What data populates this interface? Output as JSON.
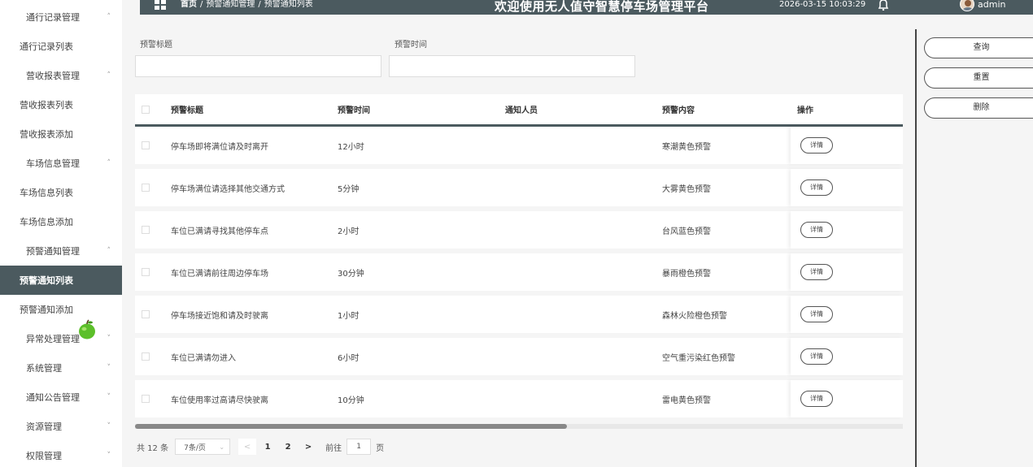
{
  "sidebar": {
    "items": [
      {
        "label": "通行记录管理",
        "type": "group",
        "chevron": "^"
      },
      {
        "label": "通行记录列表",
        "type": "link"
      },
      {
        "label": "营收报表管理",
        "type": "group",
        "chevron": "^"
      },
      {
        "label": "营收报表列表",
        "type": "link"
      },
      {
        "label": "营收报表添加",
        "type": "link"
      },
      {
        "label": "车场信息管理",
        "type": "group",
        "chevron": "^"
      },
      {
        "label": "车场信息列表",
        "type": "link"
      },
      {
        "label": "车场信息添加",
        "type": "link"
      },
      {
        "label": "预警通知管理",
        "type": "group",
        "chevron": "^"
      },
      {
        "label": "预警通知列表",
        "type": "link",
        "active": true
      },
      {
        "label": "预警通知添加",
        "type": "link"
      },
      {
        "label": "异常处理管理",
        "type": "group",
        "chevron": "v"
      },
      {
        "label": "系统管理",
        "type": "group",
        "chevron": "v"
      },
      {
        "label": "通知公告管理",
        "type": "group",
        "chevron": "v"
      },
      {
        "label": "资源管理",
        "type": "group",
        "chevron": "v"
      },
      {
        "label": "权限管理",
        "type": "group",
        "chevron": "v"
      }
    ]
  },
  "header": {
    "breadcrumb": {
      "home": "首页",
      "level1": "预警通知管理",
      "level2": "预警通知列表",
      "sep": "/"
    },
    "title": "欢迎使用无人值守智慧停车场管理平台",
    "datetime": "2026-03-15 10:03:29",
    "username": "admin"
  },
  "search": {
    "title_label": "预警标题",
    "title_value": "",
    "time_label": "预警时间",
    "time_value": ""
  },
  "actions": {
    "query": "查询",
    "reset": "重置",
    "delete": "删除"
  },
  "table": {
    "columns": [
      "预警标题",
      "预警时间",
      "通知人员",
      "预警内容",
      "操作"
    ],
    "detail_label": "详情",
    "rows": [
      {
        "title": "停车场即将满位请及时离开",
        "time": "12小时",
        "person": "",
        "content": "寒潮黄色预警"
      },
      {
        "title": "停车场满位请选择其他交通方式",
        "time": "5分钟",
        "person": "",
        "content": "大雾黄色预警"
      },
      {
        "title": "车位已满请寻找其他停车点",
        "time": "2小时",
        "person": "",
        "content": "台风蓝色预警"
      },
      {
        "title": "车位已满请前往周边停车场",
        "time": "30分钟",
        "person": "",
        "content": "暴雨橙色预警"
      },
      {
        "title": "停车场接近饱和请及时驶离",
        "time": "1小时",
        "person": "",
        "content": "森林火险橙色预警"
      },
      {
        "title": "车位已满请勿进入",
        "time": "6小时",
        "person": "",
        "content": "空气重污染红色预警"
      },
      {
        "title": "车位使用率过高请尽快驶离",
        "time": "10分钟",
        "person": "",
        "content": "雷电黄色预警"
      }
    ]
  },
  "pagination": {
    "total_text": "共 12 条",
    "page_size": "7条/页",
    "prev": "<",
    "pages": [
      "1",
      "2"
    ],
    "next": ">",
    "goto_prefix": "前往",
    "goto_value": "1",
    "goto_suffix": "页"
  },
  "colors": {
    "primary": "#4b5a5f",
    "accent_apple": "#5cbf2a"
  }
}
